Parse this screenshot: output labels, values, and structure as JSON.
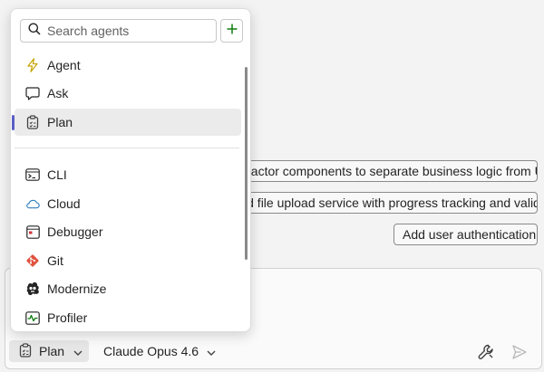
{
  "suggestions": [
    "Refactor components to separate business logic from UI",
    "Add file upload service with progress tracking and validation",
    "Add user authentication"
  ],
  "dropdown": {
    "search_placeholder": "Search agents",
    "search_value": "",
    "add_icon": "plus-icon",
    "primary_items": [
      {
        "label": "Agent",
        "icon": "lightning-icon"
      },
      {
        "label": "Ask",
        "icon": "chat-icon"
      },
      {
        "label": "Plan",
        "icon": "clipboard-icon",
        "selected": true
      }
    ],
    "secondary_items": [
      {
        "label": "CLI",
        "icon": "terminal-icon"
      },
      {
        "label": "Cloud",
        "icon": "cloud-icon"
      },
      {
        "label": "Debugger",
        "icon": "debugger-icon"
      },
      {
        "label": "Git",
        "icon": "git-icon"
      },
      {
        "label": "Modernize",
        "icon": "modernize-icon"
      },
      {
        "label": "Profiler",
        "icon": "profiler-icon"
      }
    ]
  },
  "input": {
    "mode_label": "Plan",
    "model_label": "Claude Opus 4.6",
    "tools_icon": "wrench-icon",
    "send_icon": "send-icon"
  },
  "colors": {
    "accent": "#5b5fc7",
    "add_icon": "#107c10",
    "git_icon": "#e0533e",
    "cloud_icon": "#2f7fc1",
    "profiler_icon": "#107c10",
    "agent_icon": "#c8a300"
  }
}
